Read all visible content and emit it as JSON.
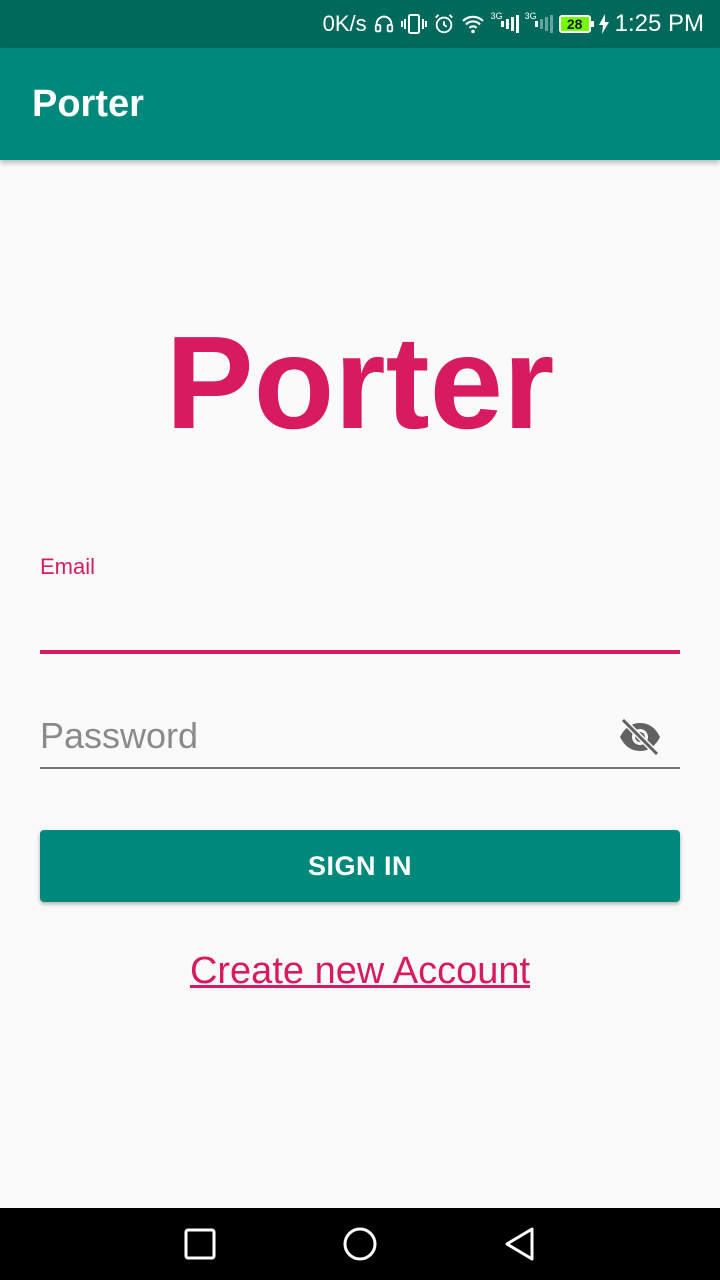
{
  "status_bar": {
    "net_speed": "0K/s",
    "signal_gen_1": "3G",
    "signal_gen_2": "3G",
    "battery_level": "28",
    "time": "1:25 PM",
    "icons": [
      "headset-icon",
      "vibrate-icon",
      "alarm-icon",
      "wifi-icon",
      "signal-icon",
      "signal-icon",
      "battery-icon",
      "charging-icon"
    ]
  },
  "app_bar": {
    "title": "Porter"
  },
  "logo": {
    "text": "Porter"
  },
  "form": {
    "email_label": "Email",
    "email_value": "",
    "password_placeholder": "Password",
    "password_value": "",
    "visibility_icon": "eye-off-icon",
    "signin_label": "SIGN IN",
    "create_account_label": "Create new Account"
  },
  "nav_bar": {
    "icons": [
      "recent-apps-icon",
      "home-icon",
      "back-icon"
    ]
  },
  "colors": {
    "status_bar": "#00695c",
    "primary": "#00897b",
    "accent": "#d81b60",
    "background": "#fafafa"
  }
}
